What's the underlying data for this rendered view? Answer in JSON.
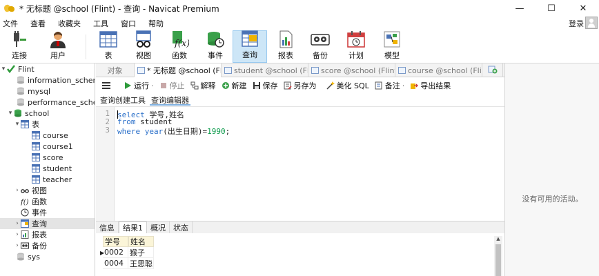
{
  "window": {
    "title": "* 无标题 @school (Flint) - 查询 - Navicat Premium",
    "minimize": "—",
    "maximize": "☐",
    "close": "✕"
  },
  "menu": {
    "items": [
      "文件",
      "查看",
      "收藏夹",
      "工具",
      "窗口",
      "帮助"
    ],
    "login": "登录"
  },
  "toolbar": {
    "connect": "连接",
    "user": "用户",
    "table": "表",
    "view": "视图",
    "function": "函数",
    "event": "事件",
    "query": "查询",
    "report": "报表",
    "backup": "备份",
    "schedule": "计划",
    "model": "模型"
  },
  "sidebar": {
    "connection": "Flint",
    "db_information_schema": "information_schema",
    "db_mysql": "mysql",
    "db_performance_schema": "performance_schema",
    "db_school": "school",
    "group_tables": "表",
    "tables": [
      "course",
      "course1",
      "score",
      "student",
      "teacher"
    ],
    "group_views": "视图",
    "group_functions": "函数",
    "group_events": "事件",
    "group_queries": "查询",
    "group_reports": "报表",
    "group_backups": "备份",
    "db_sys": "sys"
  },
  "tabs": {
    "objects": "对象",
    "query": "* 无标题 @school (Fl...",
    "student": "student @school (Fli...",
    "score": "score @school (Flint...",
    "course": "course @school (Flint..."
  },
  "query_toolbar": {
    "run": "运行",
    "stop": "停止",
    "explain": "解释",
    "new": "新建",
    "save": "保存",
    "save_as": "另存为",
    "beautify": "美化 SQL",
    "comment": "备注",
    "export": "导出结果"
  },
  "subtabs": {
    "builder": "查询创建工具",
    "editor": "查询编辑器"
  },
  "editor": {
    "line_numbers": [
      "1",
      "2",
      "3"
    ],
    "line1_kw": "select",
    "line1_rest": " 学号,姓名",
    "line2_kw": "from",
    "line2_rest": " student",
    "line3_kw": "where",
    "line3_fn": " year",
    "line3_arg": "(出生日期)=",
    "line3_num": "1990",
    "line3_end": ";"
  },
  "right_panel": {
    "empty_text": "没有可用的活动。"
  },
  "result_tabs": {
    "info": "信息",
    "result1": "结果1",
    "overview": "概况",
    "status": "状态"
  },
  "result": {
    "columns": [
      "学号",
      "姓名"
    ],
    "rows": [
      [
        "0002",
        "猴子"
      ],
      [
        "0004",
        "王思聪"
      ]
    ]
  }
}
